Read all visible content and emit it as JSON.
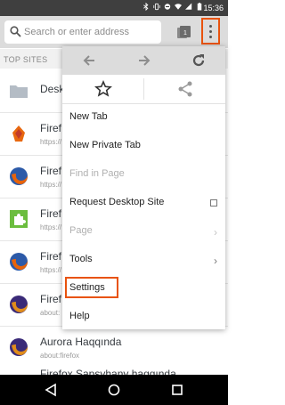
{
  "status_bar": {
    "time": "15:36",
    "icons": [
      "bluetooth-icon",
      "vibrate-icon",
      "do-not-disturb-icon",
      "wifi-icon",
      "signal-icon",
      "battery-icon"
    ]
  },
  "toolbar": {
    "url_placeholder": "Search or enter address",
    "tabs_count": "1"
  },
  "top_sites": {
    "header": "TOP SITES",
    "items": [
      {
        "title": "Deskto",
        "url": "",
        "icon": "folder-icon"
      },
      {
        "title": "Firef",
        "url": "https://",
        "icon": "firefox-marketplace-icon"
      },
      {
        "title": "Firef",
        "url": "https://",
        "icon": "firefox-logo-icon"
      },
      {
        "title": "Firef",
        "url": "https://",
        "icon": "addons-puzzle-icon"
      },
      {
        "title": "Firef",
        "url": "https://",
        "icon": "firefox-logo-icon"
      },
      {
        "title": "Firef",
        "url": "about:",
        "icon": "firefox-logo-icon"
      },
      {
        "title": "Aurora Haqqında",
        "url": "about:firefox",
        "icon": "firefox-logo-icon"
      },
      {
        "title": "Firefox Sapsyhany haqqında",
        "url": "",
        "icon": "firefox-logo-icon"
      }
    ]
  },
  "menu": {
    "nav_icons": [
      "back-icon",
      "forward-icon",
      "reload-icon"
    ],
    "action_icons": [
      "bookmark-star-icon",
      "share-icon"
    ],
    "items": [
      {
        "label": "New Tab",
        "enabled": true
      },
      {
        "label": "New Private Tab",
        "enabled": true
      },
      {
        "label": "Find in Page",
        "enabled": false
      },
      {
        "label": "Request Desktop Site",
        "enabled": true,
        "checkbox": true
      },
      {
        "label": "Page",
        "enabled": false,
        "submenu": true
      },
      {
        "label": "Tools",
        "enabled": true,
        "submenu": true
      },
      {
        "label": "Settings",
        "enabled": true,
        "highlighted": true
      },
      {
        "label": "Help",
        "enabled": true
      }
    ]
  },
  "colors": {
    "highlight": "#e8530e",
    "toolbar_bg": "#dcdcdc",
    "status_bg": "#3f3f3f"
  }
}
